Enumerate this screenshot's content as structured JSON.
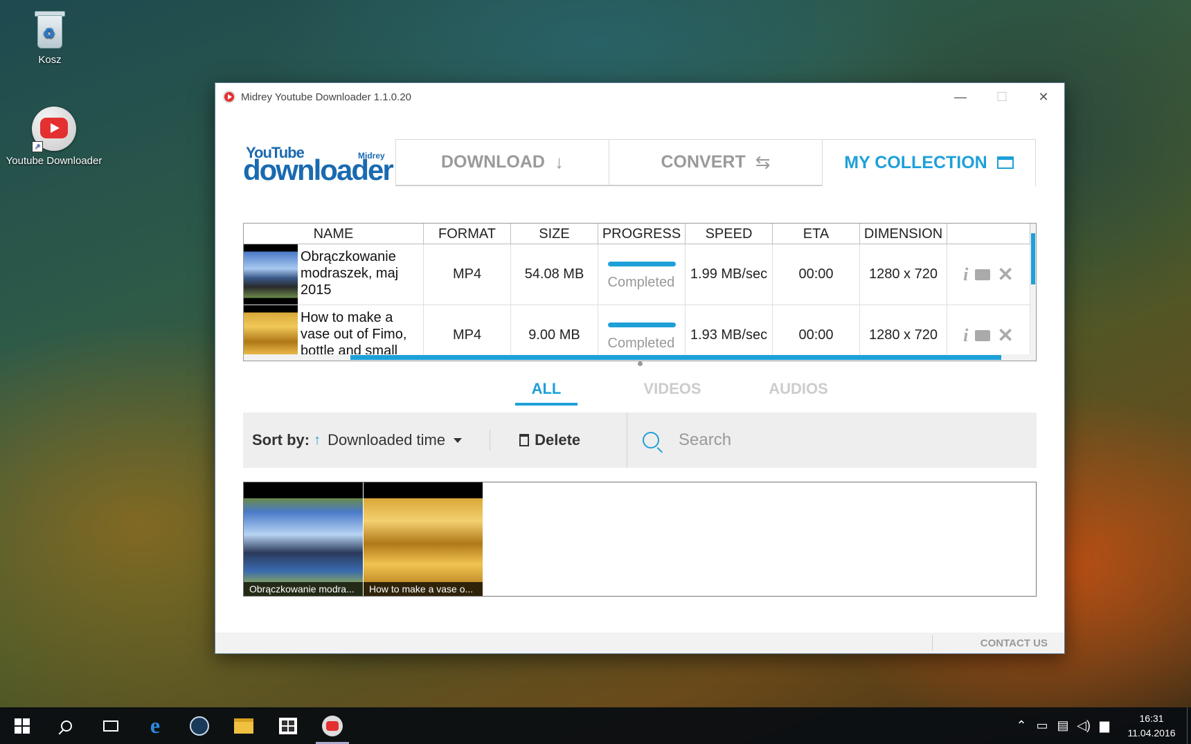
{
  "desktop": {
    "icons": [
      {
        "label": "Kosz"
      },
      {
        "label": "Youtube Downloader"
      }
    ]
  },
  "window": {
    "title": "Midrey Youtube Downloader 1.1.0.20",
    "controls": {
      "minimize": "—",
      "maximize": "☐",
      "close": "✕"
    }
  },
  "logo": {
    "line1": "YouTube",
    "line2": "downloader",
    "tag": "Midrey"
  },
  "tabs": [
    {
      "label": "DOWNLOAD",
      "icon": "↓"
    },
    {
      "label": "CONVERT",
      "icon": "⇆"
    },
    {
      "label": "MY COLLECTION",
      "icon": "folder-icon",
      "active": true
    }
  ],
  "downloads": {
    "columns": [
      "NAME",
      "FORMAT",
      "SIZE",
      "PROGRESS",
      "SPEED",
      "ETA",
      "DIMENSION",
      ""
    ],
    "rows": [
      {
        "name": "Obrączkowanie modraszek, maj 2015",
        "format": "MP4",
        "size": "54.08 MB",
        "progress": 1.0,
        "status": "Completed",
        "speed": "1.99 MB/sec",
        "eta": "00:00",
        "dimension": "1280 x 720"
      },
      {
        "name": "How to make a vase out of Fimo, bottle and small",
        "format": "MP4",
        "size": "9.00 MB",
        "progress": 1.0,
        "status": "Completed",
        "speed": "1.93 MB/sec",
        "eta": "00:00",
        "dimension": "1280 x 720"
      }
    ],
    "actions": {
      "info": "i",
      "close": "✕"
    }
  },
  "filter_tabs": [
    {
      "label": "ALL",
      "active": true
    },
    {
      "label": "VIDEOS"
    },
    {
      "label": "AUDIOS"
    }
  ],
  "toolbar": {
    "sort_label": "Sort by:",
    "sort_arrow": "↑",
    "sort_value": "Downloaded time",
    "delete_label": "Delete",
    "search_placeholder": "Search"
  },
  "gallery": [
    {
      "caption": "Obrączkowanie modra..."
    },
    {
      "caption": "How to make a vase o..."
    }
  ],
  "footer": {
    "contact": "CONTACT US"
  },
  "taskbar": {
    "clock_time": "16:31",
    "clock_date": "11.04.2016"
  },
  "colors": {
    "accent": "#1ea0d8",
    "brand": "#1a6ab0"
  }
}
